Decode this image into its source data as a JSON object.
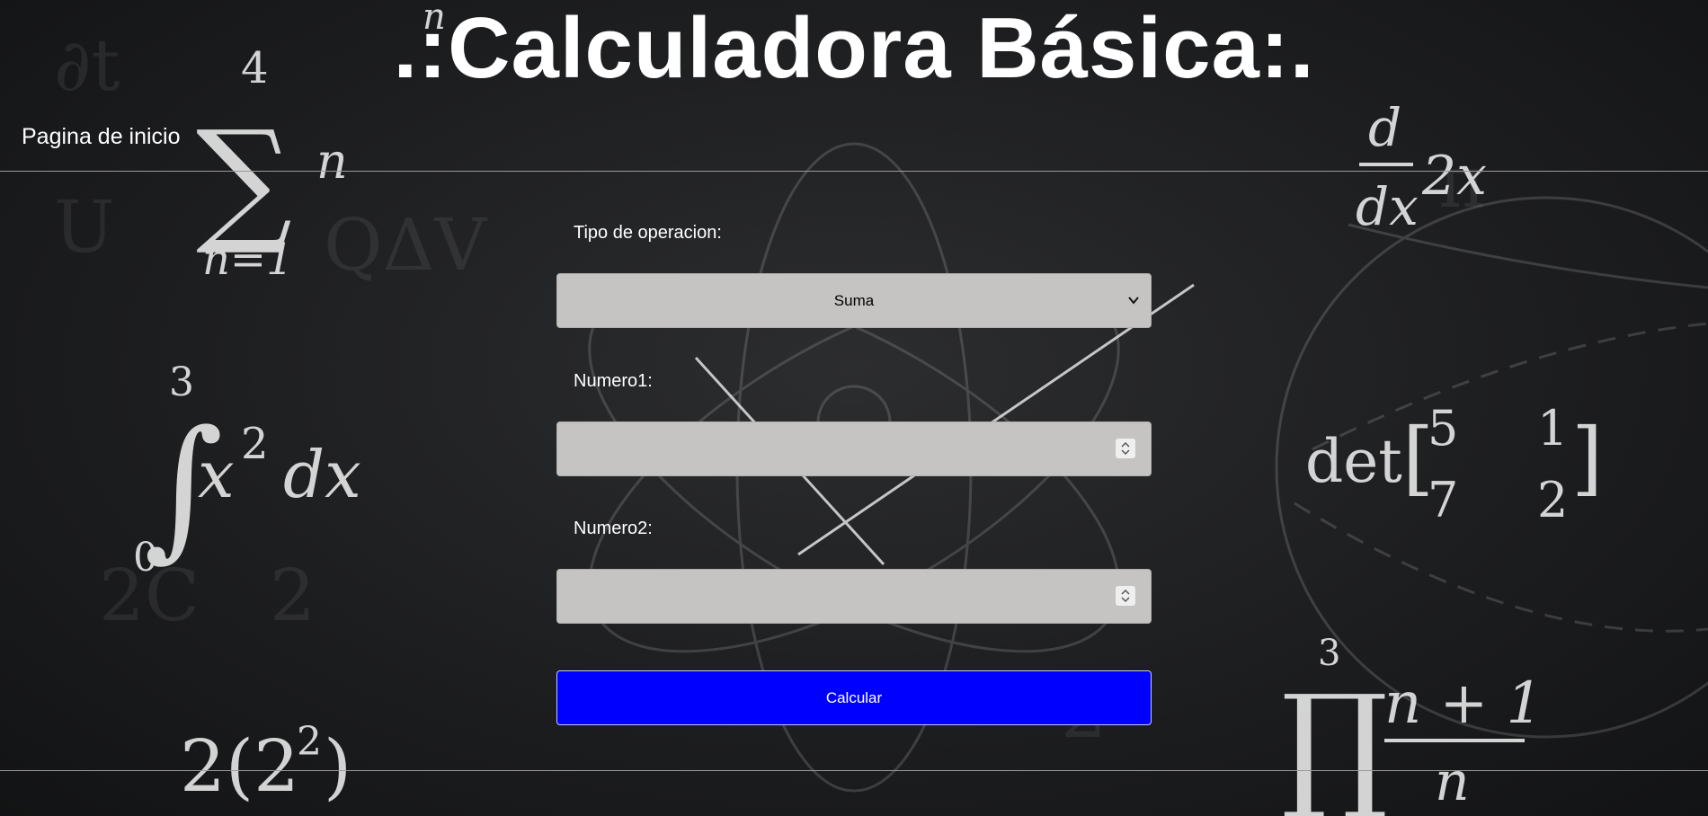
{
  "header": {
    "title": ".:Calculadora Básica:.",
    "home_link": "Pagina de inicio"
  },
  "form": {
    "operation": {
      "label": "Tipo de operacion:",
      "selected": "Suma",
      "icon": "chevron-down-icon"
    },
    "number1": {
      "label": "Numero1:",
      "value": "",
      "icon": "spinner-icon"
    },
    "number2": {
      "label": "Numero2:",
      "value": "",
      "icon": "spinner-icon"
    },
    "submit_label": "Calcular"
  },
  "colors": {
    "background": "#1d1e20",
    "field": "#c5c4c3",
    "button": "#0000ff",
    "text": "#ffffff"
  }
}
